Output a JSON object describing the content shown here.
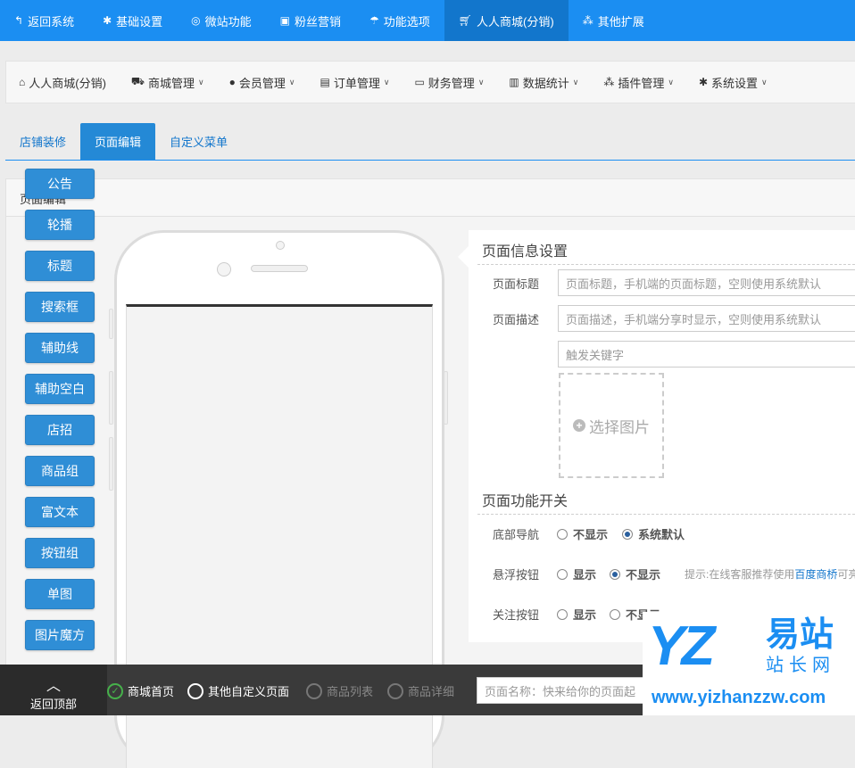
{
  "topnav": {
    "items": [
      {
        "icon": "back-icon",
        "label": "返回系统"
      },
      {
        "icon": "gear-icon",
        "label": "基础设置"
      },
      {
        "icon": "lifebuoy-icon",
        "label": "微站功能"
      },
      {
        "icon": "gift-icon",
        "label": "粉丝营销"
      },
      {
        "icon": "umbrella-icon",
        "label": "功能选项"
      },
      {
        "icon": "cart-icon",
        "label": "人人商城(分销)"
      },
      {
        "icon": "cubes-icon",
        "label": "其他扩展"
      }
    ],
    "active_index": 5
  },
  "nav2": {
    "items": [
      {
        "icon": "home-icon",
        "label": "人人商城(分销)"
      },
      {
        "icon": "cart-icon",
        "label": "商城管理"
      },
      {
        "icon": "user-icon",
        "label": "会员管理"
      },
      {
        "icon": "document-icon",
        "label": "订单管理"
      },
      {
        "icon": "money-icon",
        "label": "财务管理"
      },
      {
        "icon": "bar-chart-icon",
        "label": "数据统计"
      },
      {
        "icon": "cubes-icon",
        "label": "插件管理"
      },
      {
        "icon": "gear-icon",
        "label": "系统设置"
      }
    ]
  },
  "tabs": {
    "items": [
      "店铺装修",
      "页面编辑",
      "自定义菜单"
    ],
    "active_index": 1
  },
  "panel": {
    "title": "页面编辑"
  },
  "widgets": [
    "公告",
    "轮播",
    "标题",
    "搜索框",
    "辅助线",
    "辅助空白",
    "店招",
    "商品组",
    "富文本",
    "按钮组",
    "单图",
    "图片魔方"
  ],
  "page_info": {
    "section_title": "页面信息设置",
    "title_label": "页面标题",
    "title_placeholder": "页面标题，手机端的页面标题，空则使用系统默认",
    "desc_label": "页面描述",
    "desc_placeholder": "页面描述，手机端分享时显示，空则使用系统默认",
    "keyword_placeholder": "触发关键字",
    "select_image": "选择图片"
  },
  "page_func": {
    "section_title": "页面功能开关",
    "bottom_nav": {
      "label": "底部导航",
      "options": [
        "不显示",
        "系统默认"
      ],
      "selected": 1
    },
    "float_btn": {
      "label": "悬浮按钮",
      "options": [
        "显示",
        "不显示"
      ],
      "selected": 1,
      "hint_prefix": "提示:在线客服推荐使用",
      "hint_link": "百度商桥",
      "hint_suffix": "可亮"
    },
    "follow_btn": {
      "label": "关注按钮",
      "options": [
        "显示",
        "不显示"
      ],
      "selected": -1
    }
  },
  "bottombar": {
    "back_top": "返回顶部",
    "page_types": [
      {
        "label": "商城首页",
        "state": "checked"
      },
      {
        "label": "其他自定义页面",
        "state": "normal"
      },
      {
        "label": "商品列表",
        "state": "disabled"
      },
      {
        "label": "商品详细",
        "state": "disabled"
      }
    ],
    "name_placeholder": "页面名称：快来给你的页面起"
  },
  "watermark": {
    "logo_letters": "YZ",
    "cn_large": "易站",
    "cn_small": "站长网",
    "url": "www.yizhanzzw.com"
  },
  "colors": {
    "primary": "#1b8ef2",
    "active_top": "#1276cc",
    "widget_button": "#2f8ed6",
    "bottom_bar": "#3a3a3a",
    "check_green": "#46b14b"
  }
}
